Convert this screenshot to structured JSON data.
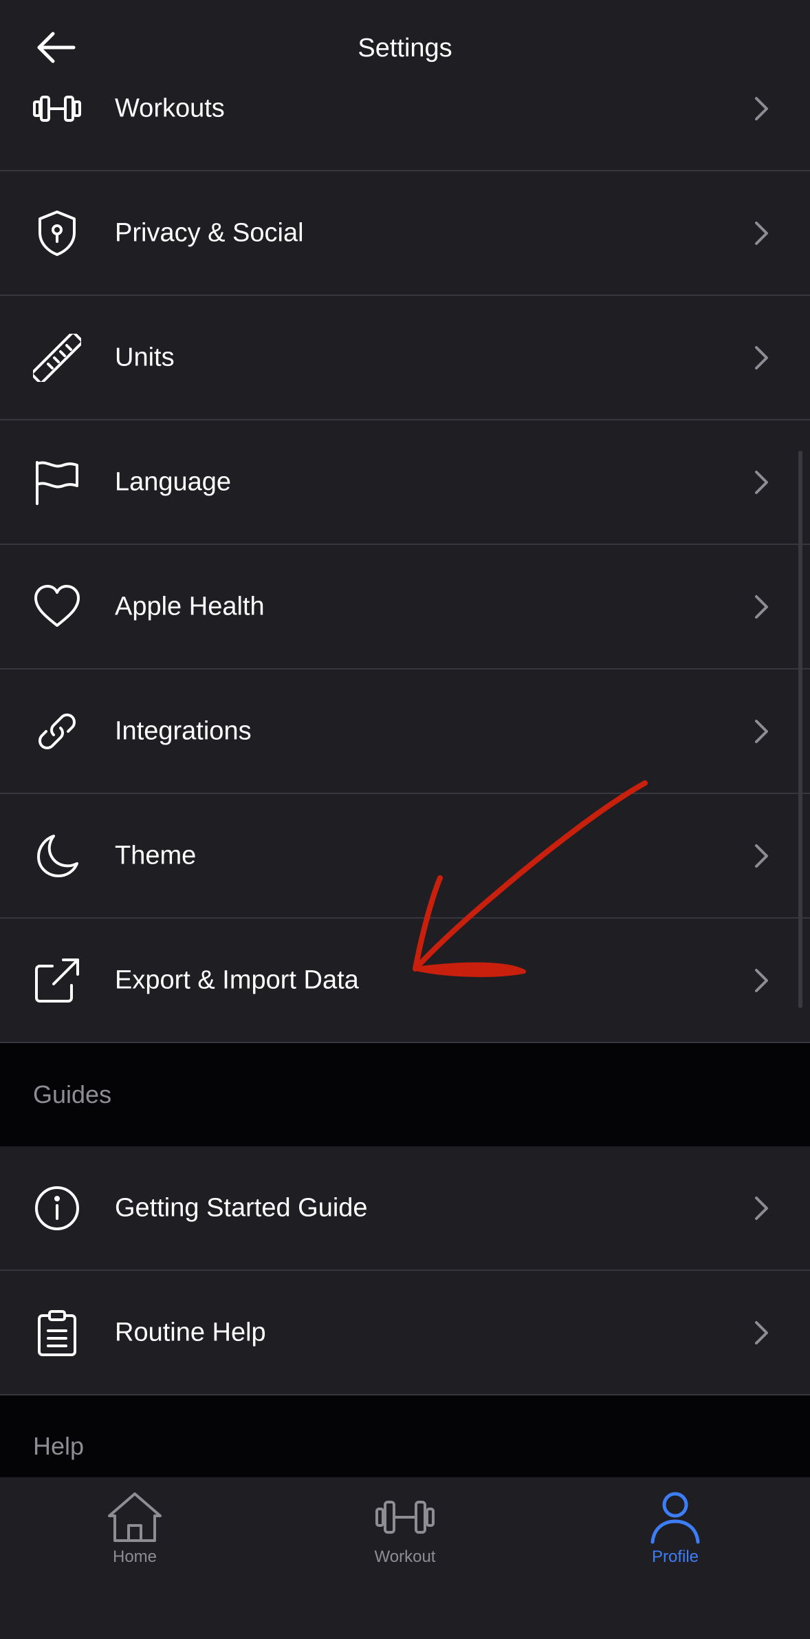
{
  "header": {
    "title": "Settings",
    "back_icon": "arrow-left-icon"
  },
  "rows_group1": [
    {
      "label": "Workouts",
      "icon": "dumbbell-icon"
    },
    {
      "label": "Privacy & Social",
      "icon": "shield-keyhole-icon"
    },
    {
      "label": "Units",
      "icon": "ruler-icon"
    },
    {
      "label": "Language",
      "icon": "flag-icon"
    },
    {
      "label": "Apple Health",
      "icon": "heart-icon"
    },
    {
      "label": "Integrations",
      "icon": "link-icon"
    },
    {
      "label": "Theme",
      "icon": "moon-icon"
    },
    {
      "label": "Export & Import Data",
      "icon": "external-link-icon"
    }
  ],
  "section_guides": {
    "label": "Guides"
  },
  "rows_group2": [
    {
      "label": "Getting Started Guide",
      "icon": "info-icon"
    },
    {
      "label": "Routine Help",
      "icon": "clipboard-icon"
    }
  ],
  "section_help": {
    "label": "Help"
  },
  "tabbar": {
    "tabs": [
      {
        "label": "Home",
        "icon": "home-icon",
        "active": false
      },
      {
        "label": "Workout",
        "icon": "dumbbell-icon",
        "active": false
      },
      {
        "label": "Profile",
        "icon": "person-icon",
        "active": true
      }
    ]
  },
  "colors": {
    "background": "#1f1e23",
    "section_background": "#040406",
    "accent": "#3d7df6",
    "annotation": "#c8200c"
  }
}
